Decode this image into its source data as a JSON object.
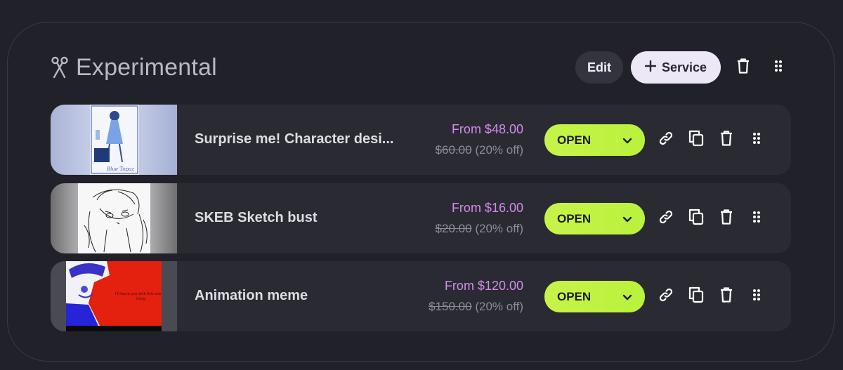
{
  "section": {
    "title": "Experimental",
    "edit_label": "Edit",
    "add_service_label": "Service"
  },
  "services": [
    {
      "title": "Surprise me! Character desi...",
      "price_from": "From $48.00",
      "price_original": "$60.00",
      "discount": "(20% off)",
      "status": "OPEN"
    },
    {
      "title": "SKEB Sketch bust",
      "price_from": "From $16.00",
      "price_original": "$20.00",
      "discount": "(20% off)",
      "status": "OPEN"
    },
    {
      "title": "Animation meme",
      "price_from": "From $120.00",
      "price_original": "$150.00",
      "discount": "(20% off)",
      "status": "OPEN",
      "thumbnail_caption": "I'll leave you with this one thing."
    }
  ],
  "colors": {
    "background": "#212129",
    "row_background": "#2a2a33",
    "price_accent": "#d38ce8",
    "status_green": "#c7f34a",
    "service_button": "#ece8f5"
  },
  "icons": {
    "section": "scissors-icon",
    "add": "plus-icon",
    "delete": "trash-icon",
    "drag": "drag-handle-icon",
    "link": "link-icon",
    "duplicate": "copy-icon",
    "dropdown": "chevron-down-icon"
  }
}
